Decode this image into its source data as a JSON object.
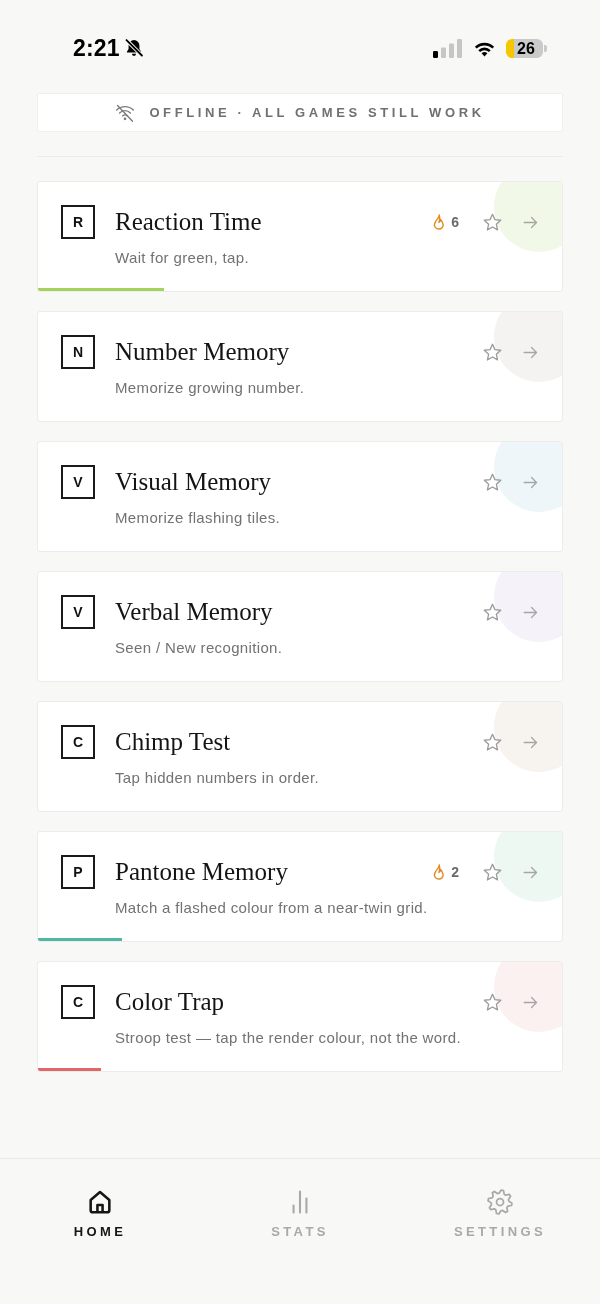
{
  "status_bar": {
    "time": "2:21",
    "battery": "26"
  },
  "banner": {
    "text": "OFFLINE · ALL GAMES STILL WORK"
  },
  "games": [
    {
      "letter": "R",
      "title": "Reaction Time",
      "description": "Wait for green, tap.",
      "color": "#f2f8e7",
      "streak": "6",
      "favorite": false,
      "progress": {
        "level": 0.24,
        "color": "#a3d35b"
      }
    },
    {
      "letter": "N",
      "title": "Number Memory",
      "description": "Memorize growing number.",
      "color": "#f5f3f1",
      "favorite": false
    },
    {
      "letter": "V",
      "title": "Visual Memory",
      "description": "Memorize flashing tiles.",
      "color": "#eef6fa",
      "favorite": false
    },
    {
      "letter": "V",
      "title": "Verbal Memory",
      "description": "Seen / New recognition.",
      "color": "#f6f2f9",
      "favorite": false
    },
    {
      "letter": "C",
      "title": "Chimp Test",
      "description": "Tap hidden numbers in order.",
      "color": "#f7f3ef",
      "favorite": false
    },
    {
      "letter": "P",
      "title": "Pantone Memory",
      "description": "Match a flashed colour from a near-twin grid.",
      "color": "#eef8f3",
      "streak": "2",
      "favorite": false,
      "progress": {
        "level": 0.16,
        "color": "#4cb8a3"
      }
    },
    {
      "letter": "C",
      "title": "Color Trap",
      "description": "Stroop test — tap the render colour, not the word.",
      "color": "#fbf1f0",
      "favorite": false,
      "progress": {
        "level": 0.12,
        "color": "#e0666a"
      }
    }
  ],
  "tabs": [
    {
      "label": "HOME",
      "selected": true
    },
    {
      "label": "STATS",
      "selected": false
    },
    {
      "label": "SETTINGS",
      "selected": false
    }
  ]
}
